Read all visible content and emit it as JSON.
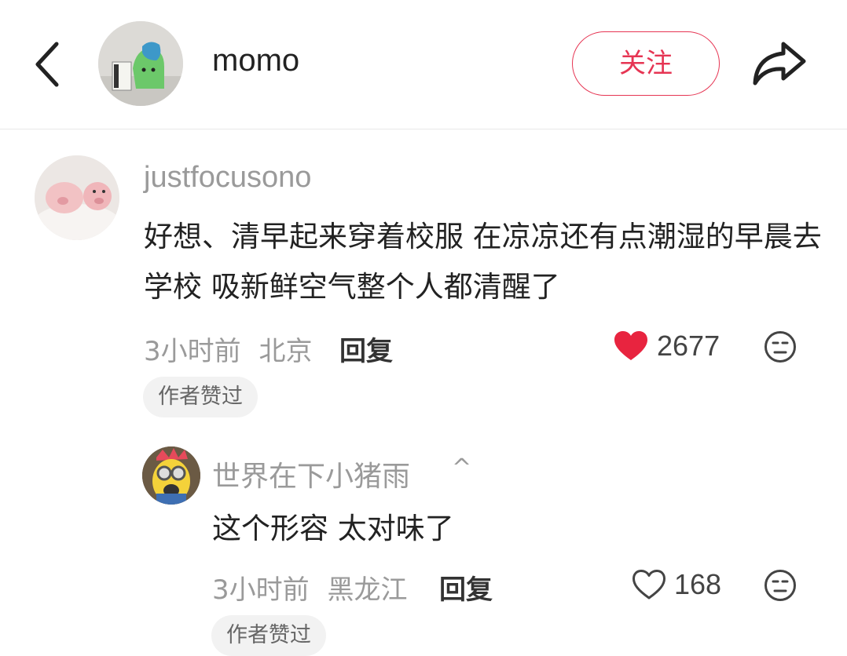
{
  "header": {
    "back_icon": "chevron-left-icon",
    "username": "momo",
    "follow_label": "关注",
    "share_icon": "share-arrow-icon",
    "accent_color": "#e63553"
  },
  "comment": {
    "username": "justfocusono",
    "text": "好想、清早起来穿着校服 在凉凉还有点潮湿的早晨去学校 吸新鲜空气整个人都清醒了",
    "time": "3小时前",
    "location": "北京",
    "reply_label": "回复",
    "likes": "2677",
    "liked": true,
    "badge": "作者赞过"
  },
  "reply": {
    "username": "世界在下小猪雨",
    "caret": "^",
    "text": "这个形容 太对味了",
    "time": "3小时前",
    "location": "黑龙江",
    "reply_label": "回复",
    "likes": "168",
    "liked": false,
    "badge": "作者赞过"
  }
}
